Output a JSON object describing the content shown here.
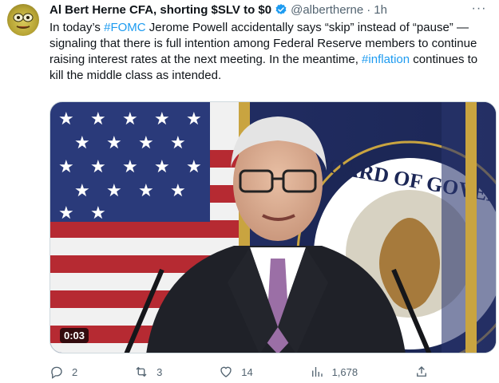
{
  "tweet": {
    "display_name": "Al Bert Herne CFA, shorting $SLV to $0",
    "handle": "@albertherne",
    "separator": "·",
    "time": "1h",
    "more_label": "···",
    "text": {
      "part1": "In today’s ",
      "hashtag1": "#FOMC",
      "part2": " Jerome Powell accidentally says “skip” instead of “pause” — signaling that there is full intention among Federal Reserve members to continue raising interest rates at the next meeting. In the meantime, ",
      "hashtag2": "#inflation",
      "part3": " continues to kill the middle class as intended."
    },
    "media": {
      "video_time": "0:03",
      "seal_text": "BOARD OF GOVERNORS"
    },
    "actions": {
      "replies": "2",
      "retweets": "3",
      "likes": "14",
      "views": "1,678"
    },
    "icons": {
      "verified": "verified-badge-icon",
      "reply": "reply-icon",
      "retweet": "retweet-icon",
      "like": "heart-icon",
      "views": "views-chart-icon",
      "share": "share-icon"
    },
    "colors": {
      "link": "#1d9bf0",
      "muted": "#536471",
      "verified": "#1d9bf0"
    }
  }
}
